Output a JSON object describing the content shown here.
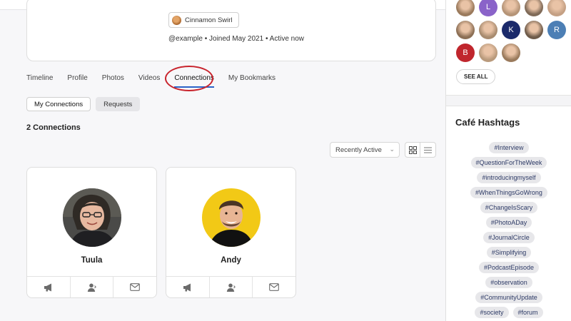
{
  "profile": {
    "badge_label": "Cinnamon Swirl",
    "meta": "@example • Joined May 2021 • Active now"
  },
  "tabs": [
    {
      "label": "Timeline"
    },
    {
      "label": "Profile"
    },
    {
      "label": "Photos"
    },
    {
      "label": "Videos"
    },
    {
      "label": "Connections",
      "active": true
    },
    {
      "label": "My Bookmarks"
    }
  ],
  "subtabs": {
    "my_connections": "My Connections",
    "requests": "Requests"
  },
  "connections": {
    "count_label": "2 Connections",
    "sort_value": "Recently Active",
    "items": [
      {
        "name": "Tuula"
      },
      {
        "name": "Andy"
      }
    ]
  },
  "members": {
    "avatars": [
      {
        "type": "photo"
      },
      {
        "type": "letter",
        "letter": "L",
        "color": "#8a63c9"
      },
      {
        "type": "photo"
      },
      {
        "type": "photo"
      },
      {
        "type": "photo"
      },
      {
        "type": "photo"
      },
      {
        "type": "photo"
      },
      {
        "type": "letter",
        "letter": "K",
        "color": "#1b2a6b"
      },
      {
        "type": "photo"
      },
      {
        "type": "letter",
        "letter": "R",
        "color": "#4c7fb5"
      },
      {
        "type": "letter",
        "letter": "B",
        "color": "#c0262d"
      },
      {
        "type": "photo"
      },
      {
        "type": "photo"
      }
    ],
    "see_all": "SEE ALL"
  },
  "hashtags": {
    "title": "Café Hashtags",
    "rows": [
      [
        "#Interview"
      ],
      [
        "#QuestionForTheWeek"
      ],
      [
        "#introducingmyself"
      ],
      [
        "#WhenThingsGoWrong"
      ],
      [
        "#ChangeIsScary"
      ],
      [
        "#PhotoADay"
      ],
      [
        "#JournalCircle"
      ],
      [
        "#Simplifying"
      ],
      [
        "#PodcastEpisode"
      ],
      [
        "#observation"
      ],
      [
        "#CommunityUpdate"
      ],
      [
        "#society",
        "#forum"
      ]
    ]
  },
  "colors": {
    "accent": "#2a63c7",
    "highlight_ring": "#c8232c",
    "tag_bg": "#e7e7ea",
    "tag_text": "#2d3a66"
  }
}
